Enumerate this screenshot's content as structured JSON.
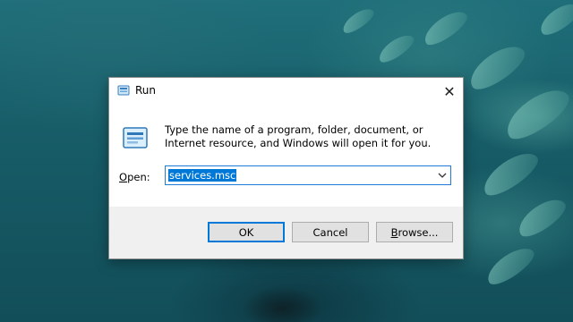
{
  "window": {
    "title": "Run",
    "close_glyph": "✕"
  },
  "content": {
    "description": "Type the name of a program, folder, document, or Internet resource, and Windows will open it for you.",
    "open_label_mnemonic": "O",
    "open_label_rest": "pen:",
    "open_value": "services.msc"
  },
  "buttons": {
    "ok": "OK",
    "cancel": "Cancel",
    "browse_mnemonic": "B",
    "browse_rest": "rowse..."
  },
  "icons": {
    "title": "run-icon",
    "main": "run-icon",
    "dropdown": "chevron-down-icon",
    "close": "close-icon"
  },
  "colors": {
    "accent": "#0078d7",
    "selection": "#0078d7",
    "dialog_bg": "#f0f0f0"
  }
}
